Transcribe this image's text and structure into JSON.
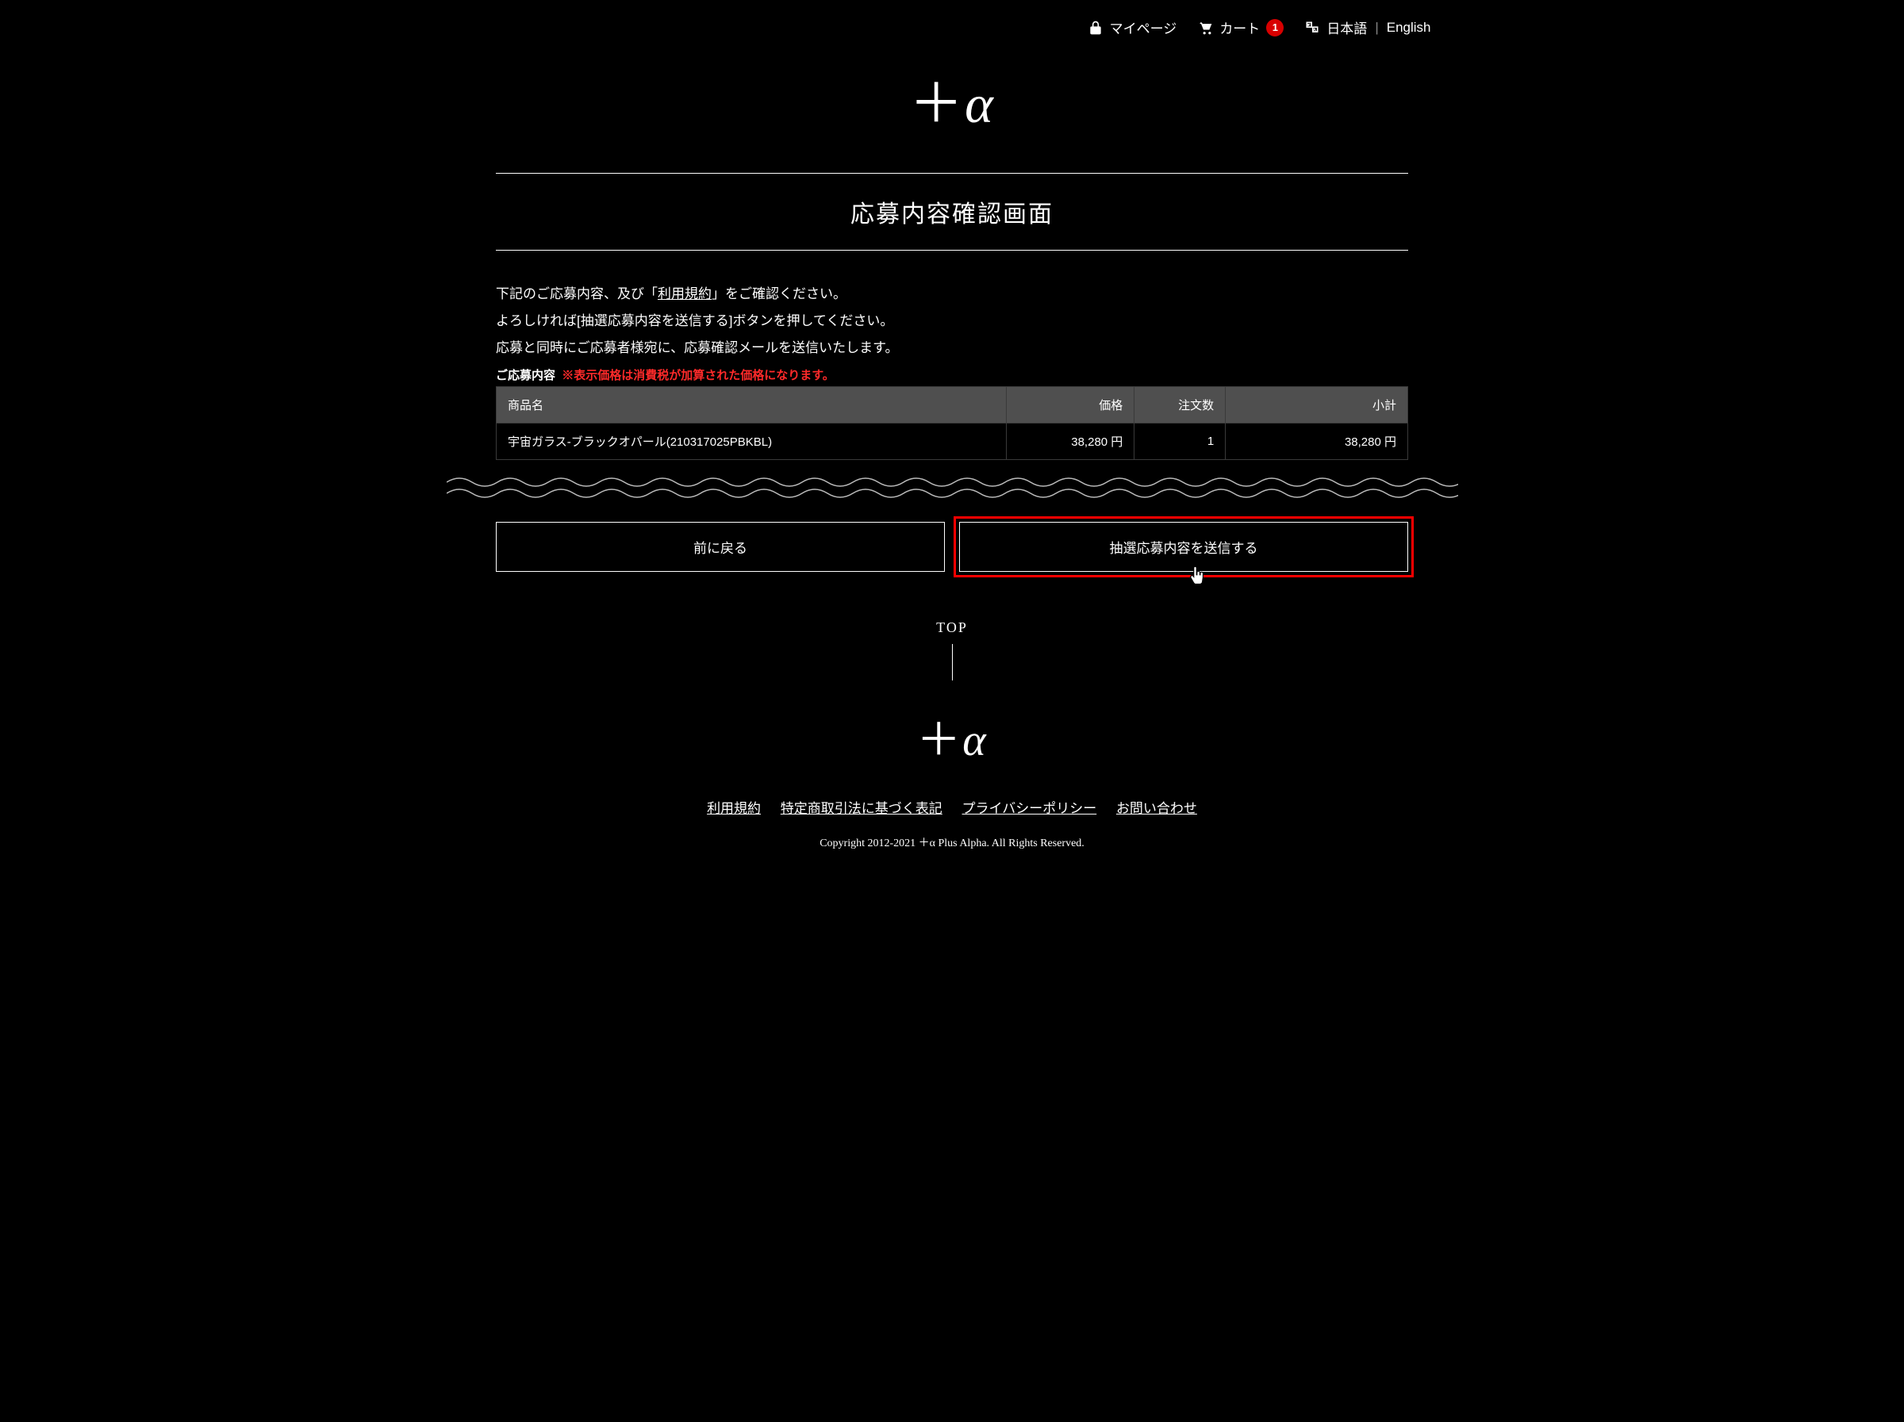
{
  "header": {
    "mypage": "マイページ",
    "cart": "カート",
    "cart_count": "1",
    "lang_ja": "日本語",
    "lang_en": "English"
  },
  "logo_text": "＋α",
  "page_title": "応募内容確認画面",
  "instructions": {
    "line1_pre": "下記のご応募内容、及び「",
    "terms_link": "利用規約",
    "line1_post": "」をご確認ください。",
    "line2": "よろしければ[抽選応募内容を送信する]ボタンを押してください。",
    "line3": "応募と同時にご応募者様宛に、応募確認メールを送信いたします。"
  },
  "order_section": {
    "label": "ご応募内容",
    "warning": "※表示価格は消費税が加算された価格になります。"
  },
  "table": {
    "headers": {
      "name": "商品名",
      "price": "価格",
      "qty": "注文数",
      "subtotal": "小計"
    },
    "rows": [
      {
        "name": "宇宙ガラス-ブラックオパール(210317025PBKBL)",
        "price": "38,280 円",
        "qty": "1",
        "subtotal": "38,280 円"
      }
    ]
  },
  "buttons": {
    "back": "前に戻る",
    "submit": "抽選応募内容を送信する"
  },
  "footer": {
    "top": "TOP",
    "links": {
      "terms": "利用規約",
      "law": "特定商取引法に基づく表記",
      "privacy": "プライバシーポリシー",
      "contact": "お問い合わせ"
    },
    "copyright": "Copyright 2012-2021 ＋α Plus Alpha. All Rights Reserved."
  }
}
